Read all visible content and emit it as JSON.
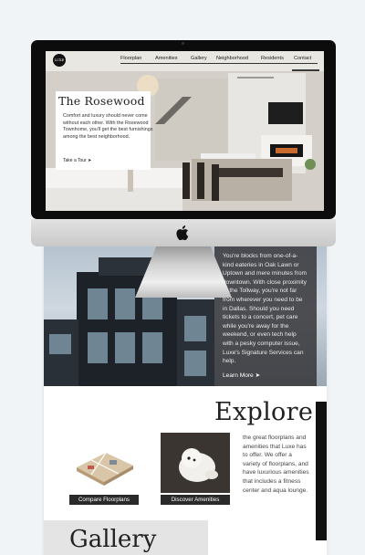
{
  "monitor": {
    "nav": {
      "logo_text": "LUXE",
      "links": [
        "Floorplan",
        "Amenities",
        "Gallery",
        "Neighborhood",
        "Residents",
        "Contact"
      ]
    },
    "hero": {
      "title": "The Rosewood",
      "body": "Comfort and luxury should never come without each other. With the Rosewood Townhome, you'll get the best furnishings among the best neighborhood.",
      "cta": "Take a Tour"
    }
  },
  "page": {
    "neighborhood": {
      "text": "You're blocks from one-of-a-kind eateries in Oak Lawn or Uptown and mere minutes from downtown. With close proximity to the Tollway, you're not far from wherever you need to be in Dallas. Should you need tickets to a concert, pet care while you're away for the weekend, or even tech help with a pesky computer issue, Luxe's Signature Services can help.",
      "cta": "Learn More"
    },
    "explore": {
      "title": "Explore",
      "text": "the great floorplans and amenities that Luxe has to offer. We offer a variety of floorplans, and have luxurious amenities that includes a fitness center and aqua lounge.",
      "cards": [
        {
          "label": "Compare Floorplans"
        },
        {
          "label": "Discover Amenities"
        }
      ]
    },
    "gallery": {
      "title": "Gallery"
    }
  },
  "icons": {
    "arrow": "circle-arrow-right-icon",
    "apple": "apple-logo-icon"
  }
}
